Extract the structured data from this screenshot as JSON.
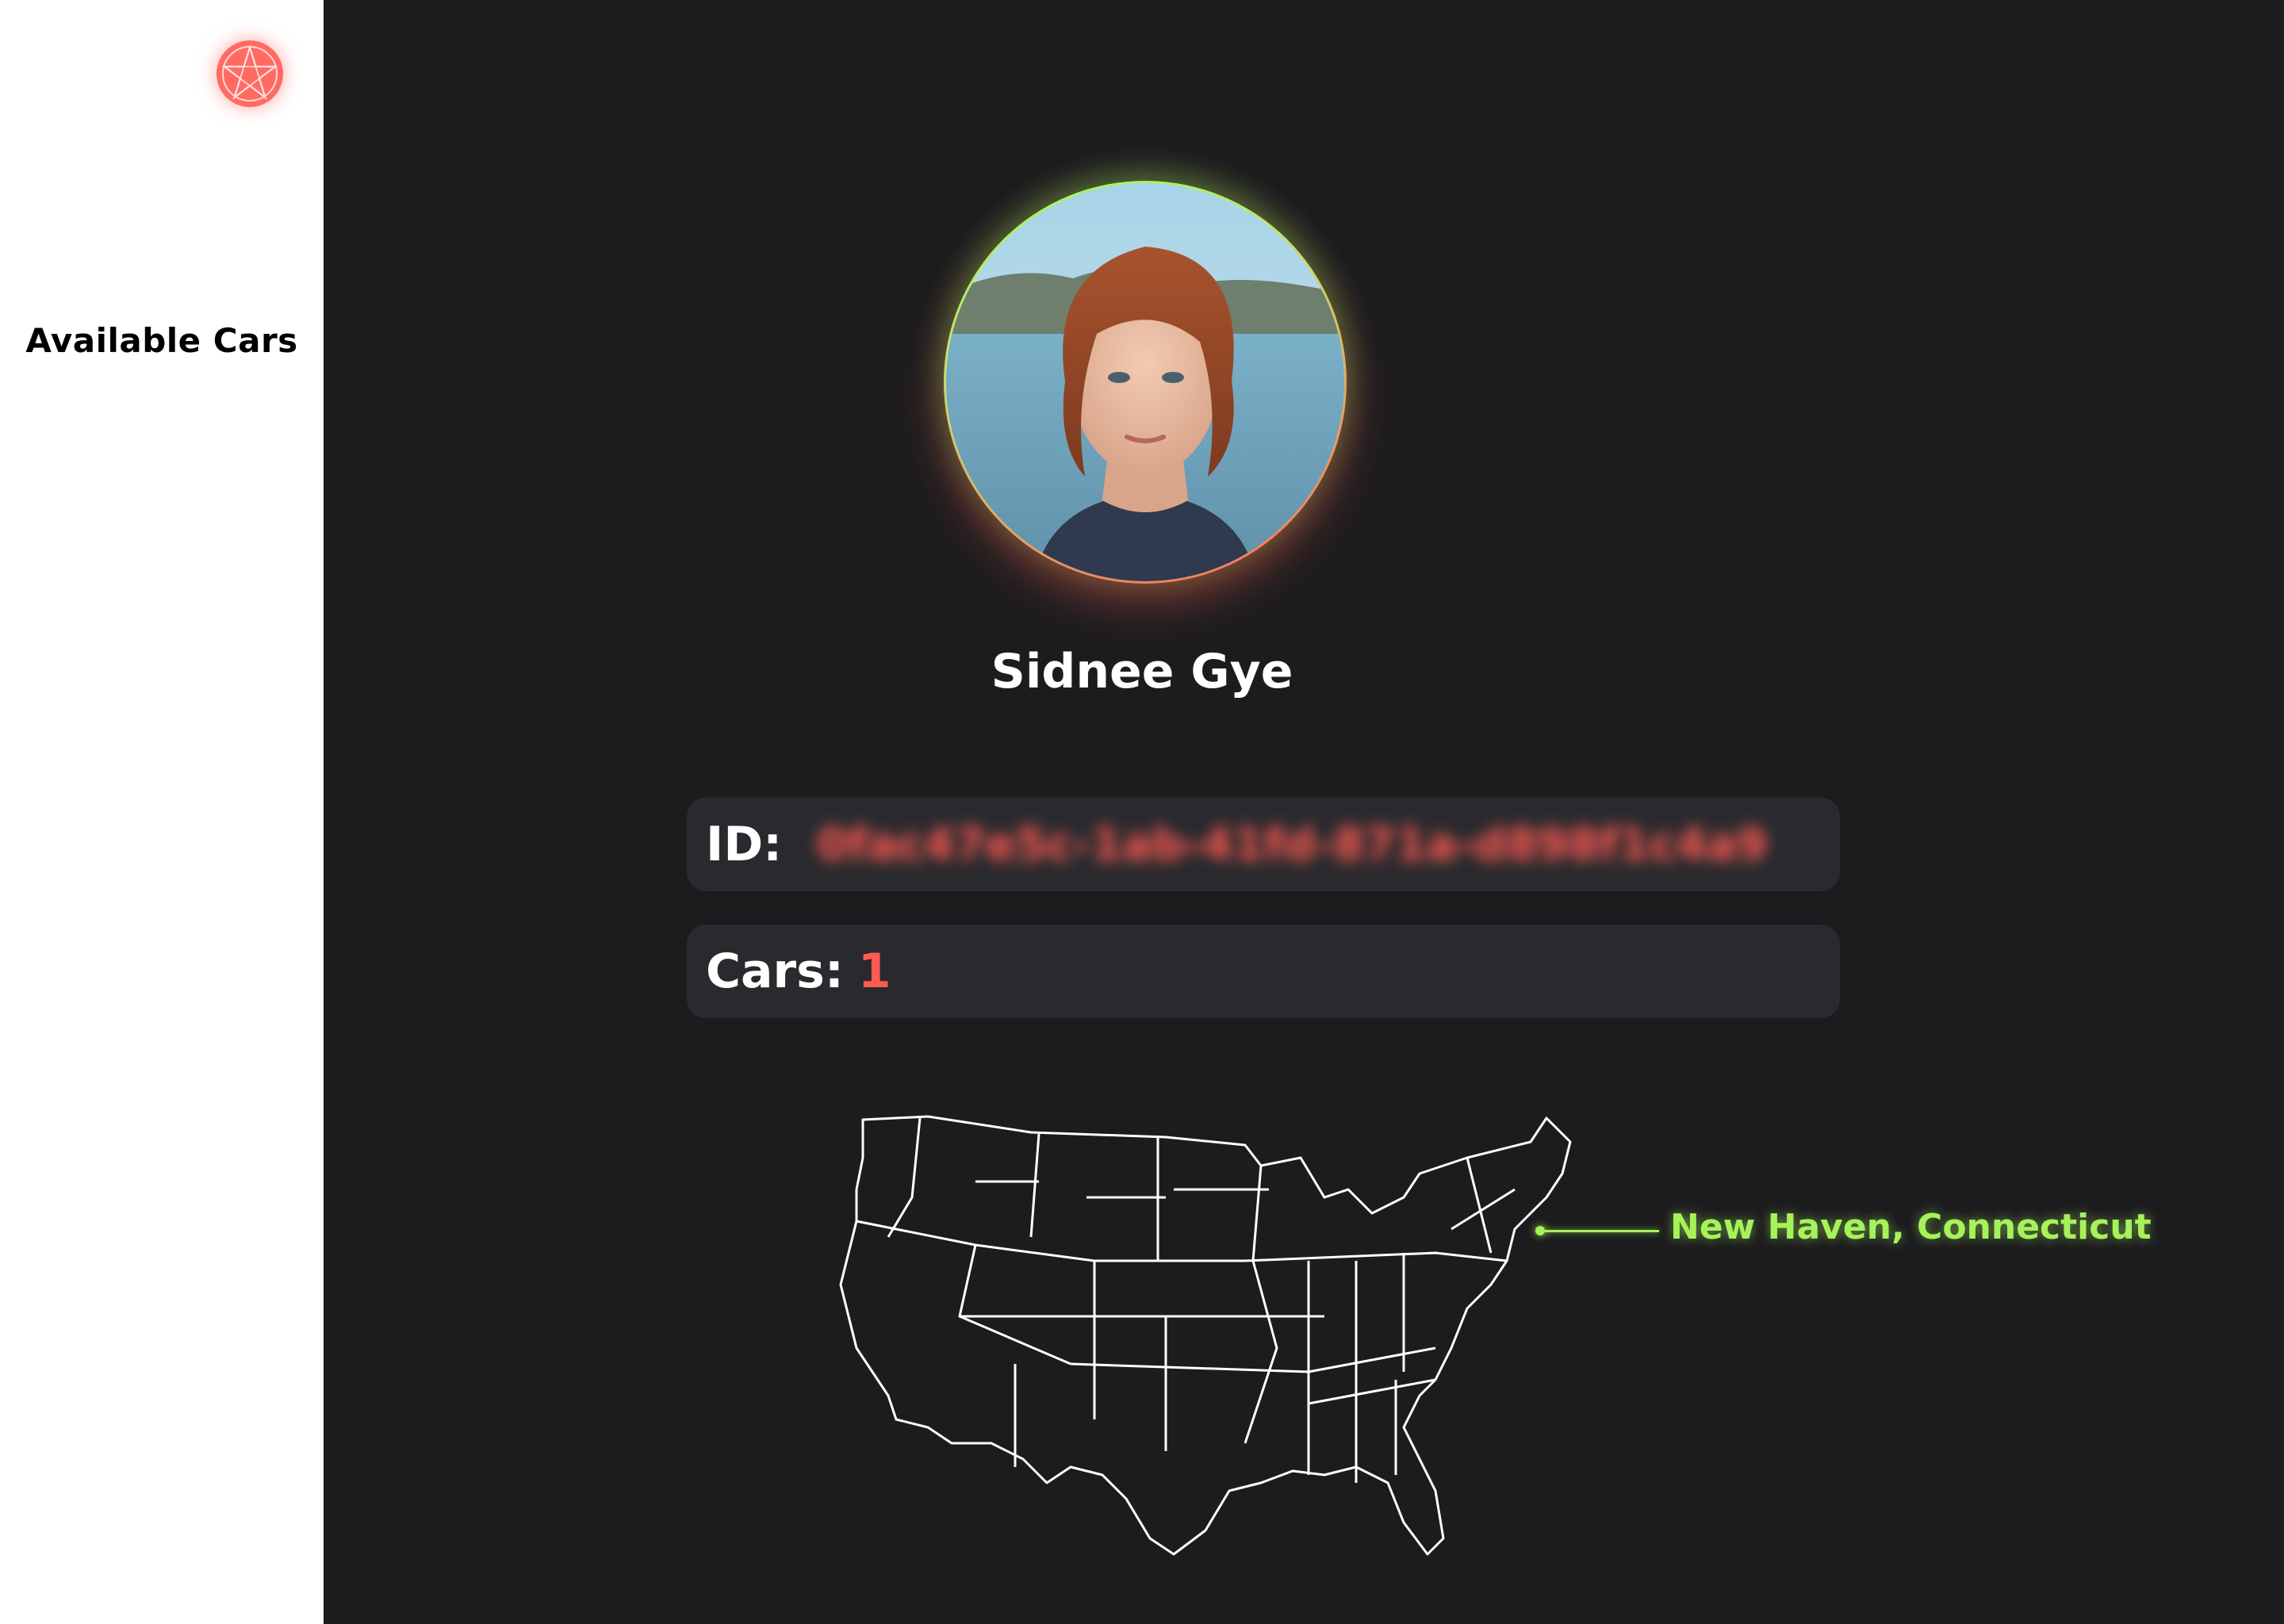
{
  "sidebar": {
    "logo_icon": "pentagram-star-icon",
    "items": [
      {
        "label": "Available Cars"
      }
    ]
  },
  "profile": {
    "avatar_icon": "user-avatar",
    "name": "Sidnee Gye",
    "id_label": "ID:",
    "id_value": "0fac47e5c-1ab-41fd-871a-d898f1c4a9",
    "cars_label": "Cars:",
    "cars_count": "1"
  },
  "map": {
    "region": "United States",
    "location_label": "New Haven, Connecticut",
    "accent_color": "#a6f25a"
  },
  "colors": {
    "background": "#1c1c1f",
    "field_background": "#2a2a2e",
    "accent_red": "#ff5a52",
    "accent_green": "#a6f25a"
  }
}
